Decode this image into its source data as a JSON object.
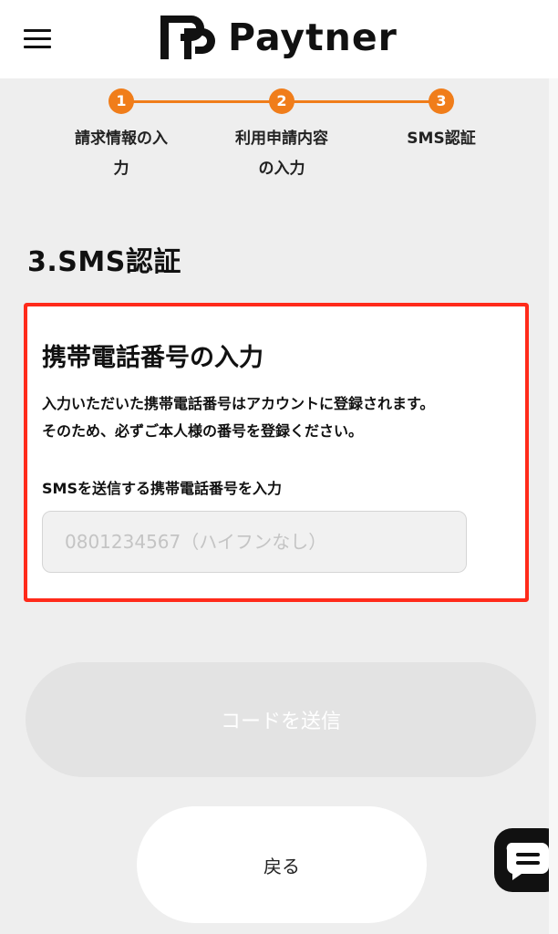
{
  "header": {
    "logo_text": "Paytner",
    "menu_icon": "hamburger-menu-icon"
  },
  "stepper": {
    "steps": [
      {
        "number": "1",
        "label_line1": "請求情報の入",
        "label_line2": "力"
      },
      {
        "number": "2",
        "label_line1": "利用申請内容",
        "label_line2": "の入力"
      },
      {
        "number": "3",
        "label_line1": "SMS認証",
        "label_line2": ""
      }
    ],
    "current_step": 3,
    "accent_color": "#f07d1a"
  },
  "section": {
    "title": "3.SMS認証"
  },
  "card": {
    "title": "携帯電話番号の入力",
    "description_line1": "入力いただいた携帯電話番号はアカウントに登録されます。",
    "description_line2": "そのため、必ずご本人様の番号を登録ください。",
    "field_label": "SMSを送信する携帯電話番号を入力",
    "phone_value": "",
    "phone_placeholder": "0801234567（ハイフンなし）",
    "highlight_color": "#ff2a1a"
  },
  "actions": {
    "send_code_label": "コードを送信",
    "back_label": "戻る"
  },
  "chat": {
    "icon": "chat-bubble-icon"
  }
}
